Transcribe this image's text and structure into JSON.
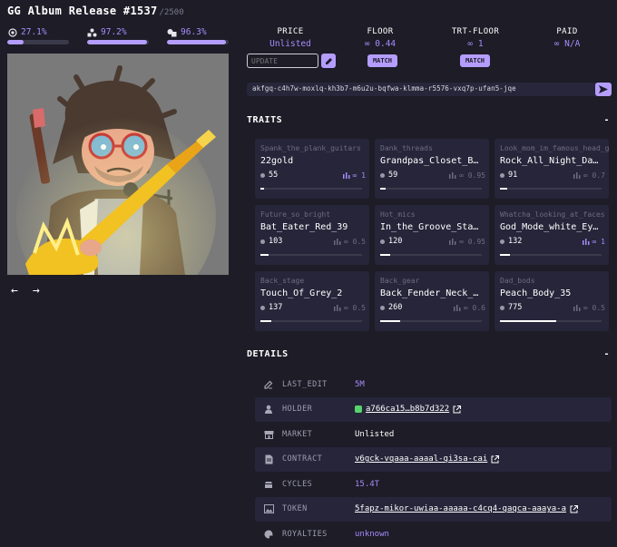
{
  "title": "GG Album Release #1537",
  "total": "/2500",
  "stats": [
    {
      "icon": "target-icon",
      "value": "27.1%",
      "fill": 0.271
    },
    {
      "icon": "triangle-icon",
      "value": "97.2%",
      "fill": 0.972
    },
    {
      "icon": "shapes-icon",
      "value": "96.3%",
      "fill": 0.963
    }
  ],
  "market": {
    "price_label": "PRICE",
    "price_value": "Unlisted",
    "floor_label": "FLOOR",
    "floor_value": "∞ 0.44",
    "trt_label": "TRT-FLOOR",
    "trt_value": "∞ 1",
    "paid_label": "PAID",
    "paid_value": "∞ N/A",
    "update_placeholder": "UPDATE",
    "match_label": "MATCH"
  },
  "address": "akfgq-c4h7w-moxlq-kh3b7-m6u2u-bqfwa-klmma-r5576-vxq7p-ufan5-jqe",
  "traits_heading": "TRAITS",
  "details_heading": "DETAILS",
  "collapse_symbol": "-",
  "traits": [
    {
      "type": "Spank_the_plank_guitars",
      "name": "22gold",
      "count": "55",
      "floor": "∞ 1",
      "hi": true,
      "bar": 0.04
    },
    {
      "type": "Dank_threads",
      "name": "Grandpas_Closet_B…",
      "count": "59",
      "floor": "∞ 0.95",
      "hi": false,
      "bar": 0.05
    },
    {
      "type": "Look_mom_im_famous_head_gear",
      "name": "Rock_All_Night_Da…",
      "count": "91",
      "floor": "∞ 0.7",
      "hi": false,
      "bar": 0.07
    },
    {
      "type": "Future_so_bright",
      "name": "Bat_Eater_Red_39",
      "count": "103",
      "floor": "∞ 0.5",
      "hi": false,
      "bar": 0.08
    },
    {
      "type": "Hot_mics",
      "name": "In_the_Groove_Sta…",
      "count": "120",
      "floor": "∞ 0.95",
      "hi": false,
      "bar": 0.1
    },
    {
      "type": "Whatcha_looking_at_faces",
      "name": "God_Mode_white_Ey…",
      "count": "132",
      "floor": "∞ 1",
      "hi": true,
      "bar": 0.1
    },
    {
      "type": "Back_stage",
      "name": "Touch_Of_Grey_2",
      "count": "137",
      "floor": "∞ 0.5",
      "hi": false,
      "bar": 0.11
    },
    {
      "type": "Back_gear",
      "name": "Back_Fender_Neck_…",
      "count": "260",
      "floor": "∞ 0.6",
      "hi": false,
      "bar": 0.2
    },
    {
      "type": "Dad_bods",
      "name": "Peach_Body_35",
      "count": "775",
      "floor": "∞ 0.5",
      "hi": false,
      "bar": 0.55
    }
  ],
  "details": [
    {
      "icon": "edit-icon",
      "label": "LAST_EDIT",
      "value": "5M",
      "style": "purple"
    },
    {
      "icon": "user-icon",
      "label": "HOLDER",
      "value": "a766ca15…b8b7d322",
      "style": "link",
      "ext": true,
      "badge": true
    },
    {
      "icon": "store-icon",
      "label": "MARKET",
      "value": "Unlisted",
      "style": "plain"
    },
    {
      "icon": "document-icon",
      "label": "CONTRACT",
      "value": "v6gck-vqaaa-aaaal-qi3sa-cai",
      "style": "link",
      "ext": true
    },
    {
      "icon": "cycles-icon",
      "label": "CYCLES",
      "value": "15.4T",
      "style": "purple"
    },
    {
      "icon": "image-icon",
      "label": "TOKEN",
      "value": "5fapz-mikor-uwiaa-aaaaa-c4cq4-qaqca-aaaya-a",
      "style": "link",
      "ext": true
    },
    {
      "icon": "palette-icon",
      "label": "ROYALTIES",
      "value": "unknown",
      "style": "purple"
    }
  ]
}
